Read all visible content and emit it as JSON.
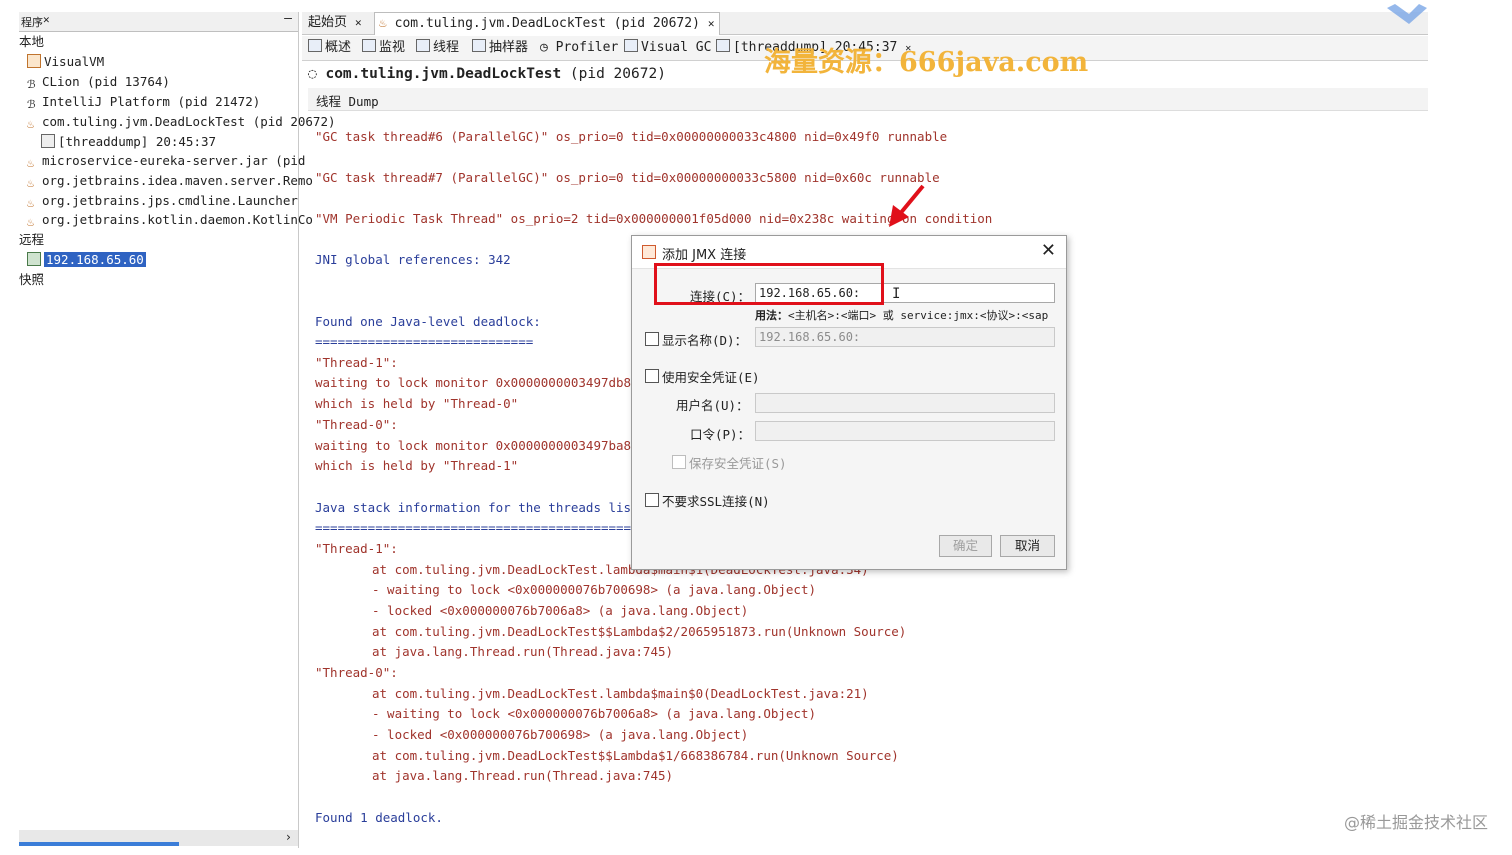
{
  "left_panel": {
    "header_title": "程序",
    "tree": [
      {
        "label": "本地"
      },
      {
        "label": "VisualVM"
      },
      {
        "label": "CLion (pid 13764)"
      },
      {
        "label": "IntelliJ Platform (pid 21472)"
      },
      {
        "label": "com.tuling.jvm.DeadLockTest (pid 20672)"
      },
      {
        "label": "[threaddump] 20:45:37"
      },
      {
        "label": "microservice-eureka-server.jar (pid"
      },
      {
        "label": "org.jetbrains.idea.maven.server.Remo"
      },
      {
        "label": "org.jetbrains.jps.cmdline.Launcher"
      },
      {
        "label": "org.jetbrains.kotlin.daemon.KotlinCo"
      },
      {
        "label": "远程"
      },
      {
        "label": "192.168.65.60"
      },
      {
        "label": "快照"
      }
    ]
  },
  "tabs": [
    {
      "label": "起始页"
    },
    {
      "label": "com.tuling.jvm.DeadLockTest (pid 20672)"
    }
  ],
  "subtabs": [
    {
      "label": "概述"
    },
    {
      "label": "监视"
    },
    {
      "label": "线程"
    },
    {
      "label": "抽样器"
    },
    {
      "label": "Profiler"
    },
    {
      "label": "Visual GC"
    },
    {
      "label": "[threaddump] 20:45:37"
    }
  ],
  "process_title": {
    "name": "com.tuling.jvm.DeadLockTest",
    "pid": "(pid 20672)"
  },
  "thread_dump_header": "线程 Dump",
  "dump_lines": [
    "\"GC task thread#6 (ParallelGC)\" os_prio=0 tid=0x00000000033c4800 nid=0x49f0 runnable",
    "\"GC task thread#7 (ParallelGC)\" os_prio=0 tid=0x00000000033c5800 nid=0x60c runnable",
    "\"VM Periodic Task Thread\" os_prio=2 tid=0x000000001f05d000 nid=0x238c waiting on condition",
    "JNI global references: 342",
    "Found one Java-level deadlock:",
    "=============================",
    "\"Thread-1\":",
    "  waiting to lock monitor 0x0000000003497db8",
    "  which is held by \"Thread-0\"",
    "\"Thread-0\":",
    "  waiting to lock monitor 0x0000000003497ba8",
    "  which is held by \"Thread-1\"",
    "Java stack information for the threads listed",
    "===================================================",
    "\"Thread-1\":",
    "at com.tuling.jvm.DeadLockTest.lambda$main$1(DeadLockTest.java:34)",
    "- waiting to lock <0x000000076b700698> (a java.lang.Object)",
    "- locked <0x000000076b7006a8> (a java.lang.Object)",
    "at com.tuling.jvm.DeadLockTest$$Lambda$2/2065951873.run(Unknown Source)",
    "at java.lang.Thread.run(Thread.java:745)",
    "\"Thread-0\":",
    "at com.tuling.jvm.DeadLockTest.lambda$main$0(DeadLockTest.java:21)",
    "- waiting to lock <0x000000076b7006a8> (a java.lang.Object)",
    "- locked <0x000000076b700698> (a java.lang.Object)",
    "at com.tuling.jvm.DeadLockTest$$Lambda$1/668386784.run(Unknown Source)",
    "at java.lang.Thread.run(Thread.java:745)",
    "Found 1 deadlock."
  ],
  "watermark": "海量资源：666java.com",
  "juejin_mark": "@稀土掘金技术社区",
  "dialog": {
    "title": "添加 JMX 连接",
    "connection_label": "连接(C)：",
    "connection_value": "192.168.65.60:",
    "usage_bold": "用法：",
    "usage_text": "<主机名>:<端口> 或 service:jmx:<协议>:<sap",
    "display_name_label": "显示名称(D)：",
    "display_name_value": "192.168.65.60:",
    "use_security_label": "使用安全凭证(E)",
    "username_label": "用户名(U)：",
    "username_value": "",
    "password_label": "口令(P)：",
    "password_value": "",
    "save_security_label": "保存安全凭证(S)",
    "no_ssl_label": "不要求SSL连接(N)",
    "ok_label": "确定",
    "cancel_label": "取消"
  },
  "colors": {
    "accent_red": "#e0101a",
    "selection": "#2f63c2",
    "dump_blue": "#2a3e9a",
    "dump_brown": "#a0342c"
  }
}
